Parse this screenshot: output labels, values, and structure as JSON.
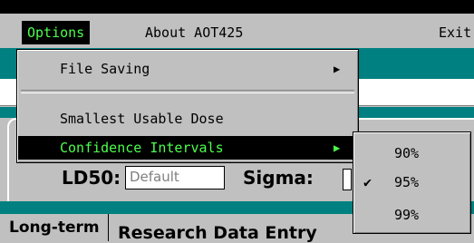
{
  "menubar": {
    "options": "Options",
    "about": "About AOT425",
    "exit": "Exit"
  },
  "background": {
    "ld_label": "LD50:",
    "default_value": "Default",
    "sigma_label": "Sigma:",
    "long_term": "Long-term",
    "research_text": "Research Data Entry"
  },
  "dropdown": {
    "items": [
      "File Saving",
      "Smallest Usable Dose",
      "Confidence Intervals"
    ],
    "submenu_arrow": "▶"
  },
  "submenu": {
    "items": [
      "90%",
      "95%",
      "99%"
    ],
    "checked_index": 1,
    "check_mark": "✔"
  },
  "colors": {
    "highlight_bg": "#000000",
    "highlight_text": "#4cff4c",
    "teal": "#008080",
    "face": "#c0c0c0"
  }
}
